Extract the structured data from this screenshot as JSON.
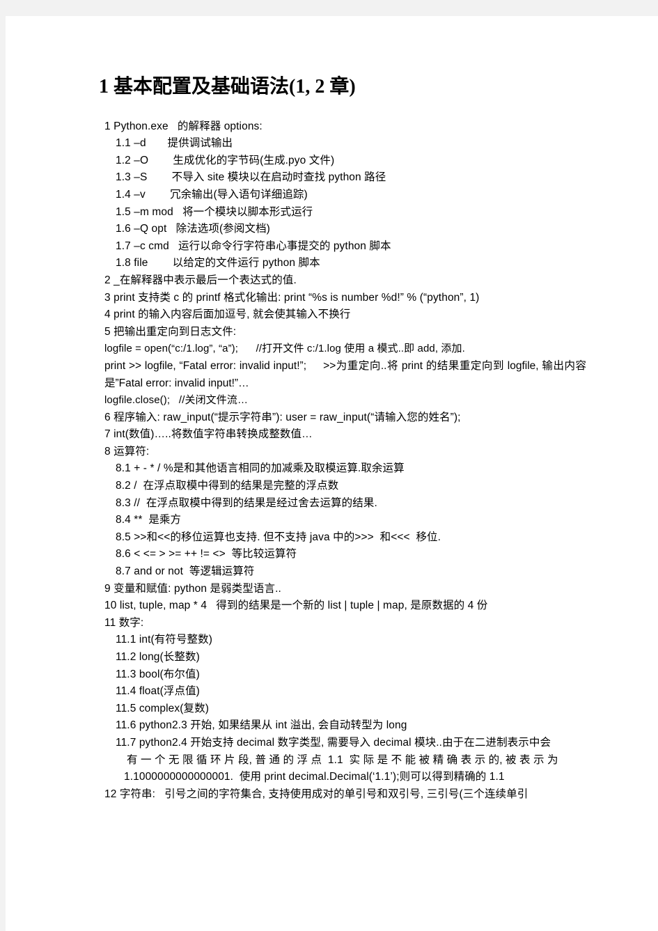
{
  "document": {
    "title": "1 基本配置及基础语法(1, 2 章)",
    "lines": [
      {
        "id": "l1",
        "indent": 1,
        "text": "1 Python.exe   的解释器 options:"
      },
      {
        "id": "l1_1",
        "indent": 2,
        "text": "1.1 –d       提供调试输出"
      },
      {
        "id": "l1_2",
        "indent": 2,
        "text": "1.2 –O        生成优化的字节码(生成.pyo 文件)"
      },
      {
        "id": "l1_3",
        "indent": 2,
        "text": "1.3 –S        不导入 site 模块以在启动时查找 python 路径"
      },
      {
        "id": "l1_4",
        "indent": 2,
        "text": "1.4 –v        冗余输出(导入语句详细追踪)"
      },
      {
        "id": "l1_5",
        "indent": 2,
        "text": "1.5 –m mod   将一个模块以脚本形式运行"
      },
      {
        "id": "l1_6",
        "indent": 2,
        "text": "1.6 –Q opt   除法选项(参阅文档)"
      },
      {
        "id": "l1_7",
        "indent": 2,
        "text": "1.7 –c cmd   运行以命令行字符串心事提交的 python 脚本"
      },
      {
        "id": "l1_8",
        "indent": 2,
        "text": "1.8 file        以给定的文件运行 python 脚本"
      },
      {
        "id": "l2",
        "indent": 1,
        "text": "2 _在解释器中表示最后一个表达式的值."
      },
      {
        "id": "l3",
        "indent": 1,
        "text": "3 print 支持类 c 的 printf 格式化输出: print “%s is number %d!” % (“python”, 1)"
      },
      {
        "id": "l4",
        "indent": 1,
        "text": "4 print 的输入内容后面加逗号, 就会使其输入不换行"
      },
      {
        "id": "l5",
        "indent": 1,
        "text": "5 把输出重定向到日志文件:"
      },
      {
        "id": "c1",
        "indent": 1,
        "code": true,
        "text": "logfile = open(“c:/1.log”, “a”);      //打开文件 c:/1.log 使用 a 模式..即 add, 添加."
      },
      {
        "id": "c2",
        "indent": 1,
        "code": true,
        "wrap": true,
        "text": "print >> logfile, “Fatal error: invalid input!”;     >>为重定向..将 print 的结果重定向到 logfile, 输出内容是”Fatal error: invalid input!”…"
      },
      {
        "id": "c3",
        "indent": 1,
        "code": true,
        "text": "logfile.close();   //关闭文件流…"
      },
      {
        "id": "l6",
        "indent": 1,
        "text": "6 程序输入: raw_input(“提示字符串”): user = raw_input(“请输入您的姓名”);"
      },
      {
        "id": "l7",
        "indent": 1,
        "text": "7 int(数值)…..将数值字符串转换成整数值…"
      },
      {
        "id": "l8",
        "indent": 1,
        "text": "8 运算符:"
      },
      {
        "id": "l8_1",
        "indent": 2,
        "text": "8.1 + - * / %是和其他语言相同的加减乘及取模运算.取余运算"
      },
      {
        "id": "l8_2",
        "indent": 2,
        "text": "8.2 /  在浮点取模中得到的结果是完整的浮点数"
      },
      {
        "id": "l8_3",
        "indent": 2,
        "text": "8.3 //  在浮点取模中得到的结果是经过舍去运算的结果."
      },
      {
        "id": "l8_4",
        "indent": 2,
        "text": "8.4 **  是乘方"
      },
      {
        "id": "l8_5",
        "indent": 2,
        "text": "8.5 >>和<<的移位运算也支持. 但不支持 java 中的>>>  和<<<  移位."
      },
      {
        "id": "l8_6",
        "indent": 2,
        "text": "8.6 < <= > >= ++ != <>  等比较运算符"
      },
      {
        "id": "l8_7",
        "indent": 2,
        "text": "8.7 and or not  等逻辑运算符"
      },
      {
        "id": "l9",
        "indent": 1,
        "text": "9 变量和赋值: python 是弱类型语言.."
      },
      {
        "id": "l10",
        "indent": 1,
        "text": "10 list, tuple, map * 4   得到的结果是一个新的 list | tuple | map, 是原数据的 4 份"
      },
      {
        "id": "l11",
        "indent": 1,
        "text": "11 数字:"
      },
      {
        "id": "l11_1",
        "indent": 2,
        "text": "11.1 int(有符号整数)"
      },
      {
        "id": "l11_2",
        "indent": 2,
        "text": "11.2 long(长整数)"
      },
      {
        "id": "l11_3",
        "indent": 2,
        "text": "11.3 bool(布尔值)"
      },
      {
        "id": "l11_4",
        "indent": 2,
        "text": "11.4 float(浮点值)"
      },
      {
        "id": "l11_5",
        "indent": 2,
        "text": "11.5 complex(复数)"
      },
      {
        "id": "l11_6",
        "indent": 2,
        "text": "11.6 python2.3 开始, 如果结果从 int 溢出, 会自动转型为 long"
      },
      {
        "id": "l11_7",
        "indent": 2,
        "wrap": true,
        "text": "11.7 python2.4 开始支持 decimal 数字类型, 需要导入 decimal 模块..由于在二进制表示中会"
      },
      {
        "id": "l11_7b",
        "indent": 3,
        "text": "有 一 个 无 限 循 环 片 段, 普 通 的 浮 点  1.1  实 际 是 不 能 被 精 确 表 示 的, 被 表 示 为"
      },
      {
        "id": "l11_7c",
        "indent": 3,
        "text": "1.1000000000000001.  使用 print decimal.Decimal(‘1.1’);则可以得到精确的 1.1"
      },
      {
        "id": "l12",
        "indent": 1,
        "text": "12 字符串:   引号之间的字符集合, 支持使用成对的单引号和双引号, 三引号(三个连续单引"
      }
    ]
  }
}
